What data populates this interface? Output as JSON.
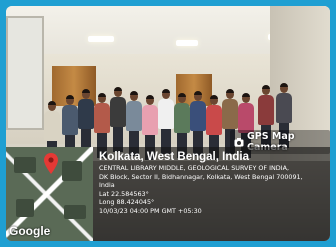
{
  "overlay": {
    "app_name": "GPS Map Camera",
    "location_title": "Kolkata, West Bengal, India",
    "address_line_1": "CENTRAL LIBRARY MIDDLE, GEOLOGICAL SURVEY OF INDIA,",
    "address_line_2": "DK Block, Sector II, Bidhannagar, Kolkata, West Bengal 700091,",
    "address_line_3": "India",
    "latitude": "Lat 22.584563°",
    "longitude": "Long 88.424045°",
    "timestamp": "10/03/23 04:00 PM GMT +05:30"
  },
  "map": {
    "provider_logo": "Google",
    "pin_icon": "map-pin-icon",
    "pin_color": "#e53935"
  },
  "colors": {
    "border": "#1f9fd2",
    "panel": "rgba(20,20,20,0.62)"
  }
}
